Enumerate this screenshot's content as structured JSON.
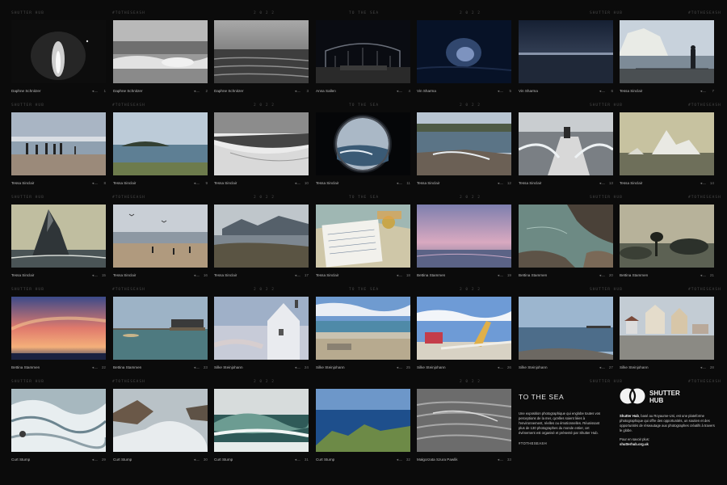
{
  "band_labels": [
    [
      "SHUTTER HUB",
      "#TOTHESEASH",
      "2 0 2 2",
      "TO THE SEA",
      "2 0 2 2",
      "SHUTTER HUB",
      "#TOTHESEASH"
    ],
    [
      "SHUTTER HUB",
      "#TOTHESEASH",
      "2 0 2 2",
      "TO THE SEA",
      "2 0 2 2",
      "SHUTTER HUB",
      "#TOTHESEASH"
    ],
    [
      "SHUTTER HUB",
      "#TOTHESEASH",
      "2 0 2 2",
      "TO THE SEA",
      "2 0 2 2",
      "SHUTTER HUB",
      "#TOTHESEASH"
    ],
    [
      "SHUTTER HUB",
      "#TOTHESEASH",
      "2 0 2 2",
      "TO THE SEA",
      "2 0 2 2",
      "SHUTTER HUB",
      "#TOTHESEASH"
    ],
    [
      "SHUTTER HUB",
      "#TOTHESEASH",
      "2 0 2 2",
      "",
      "2 0 2 2",
      "SHUTTER HUB",
      "#TOTHESEASH"
    ]
  ],
  "photos": [
    {
      "photographer": "Daphne Schnitzer",
      "number": "1"
    },
    {
      "photographer": "Daphne Schnitzer",
      "number": "2"
    },
    {
      "photographer": "Daphne Schnitzer",
      "number": "3"
    },
    {
      "photographer": "Anna Sallen",
      "number": "4"
    },
    {
      "photographer": "Vin Sharma",
      "number": "5"
    },
    {
      "photographer": "Vin Sharma",
      "number": "6"
    },
    {
      "photographer": "Tessa Sinclair",
      "number": "7"
    },
    {
      "photographer": "Tessa Sinclair",
      "number": "8"
    },
    {
      "photographer": "Tessa Sinclair",
      "number": "9"
    },
    {
      "photographer": "Tessa Sinclair",
      "number": "10"
    },
    {
      "photographer": "Tessa Sinclair",
      "number": "11"
    },
    {
      "photographer": "Tessa Sinclair",
      "number": "12"
    },
    {
      "photographer": "Tessa Sinclair",
      "number": "13"
    },
    {
      "photographer": "Tessa Sinclair",
      "number": "14"
    },
    {
      "photographer": "Tessa Sinclair",
      "number": "15"
    },
    {
      "photographer": "Tessa Sinclair",
      "number": "16"
    },
    {
      "photographer": "Tessa Sinclair",
      "number": "17"
    },
    {
      "photographer": "Tessa Sinclair",
      "number": "18"
    },
    {
      "photographer": "Bettina Stammen",
      "number": "19"
    },
    {
      "photographer": "Bettina Stammen",
      "number": "20"
    },
    {
      "photographer": "Bettina Stammen",
      "number": "21"
    },
    {
      "photographer": "Bettina Stammen",
      "number": "22"
    },
    {
      "photographer": "Bettina Stammen",
      "number": "23"
    },
    {
      "photographer": "Silke Steinjohann",
      "number": "24"
    },
    {
      "photographer": "Silke Steinjohann",
      "number": "25"
    },
    {
      "photographer": "Silke Steinjohann",
      "number": "26"
    },
    {
      "photographer": "Silke Steinjohann",
      "number": "27"
    },
    {
      "photographer": "Silke Steinjohann",
      "number": "28"
    },
    {
      "photographer": "Curt Stump",
      "number": "29"
    },
    {
      "photographer": "Curt Stump",
      "number": "30"
    },
    {
      "photographer": "Curt Stump",
      "number": "31"
    },
    {
      "photographer": "Curt Stump",
      "number": "32"
    },
    {
      "photographer": "Małgorzata Szura Pawlik",
      "number": "33"
    }
  ],
  "caption_icon": "ship-icon",
  "info": {
    "title": "TO THE SEA",
    "text": "Une exposition photographique qui englobe toutes vos perceptions de la mer, qu'elles soient liées à l'environnement, réelles ou émotionnelles. Réunissant plus de 130 photographes du monde entier, cet événement est organisé et présenté par Shutter Hub.",
    "hashtag": "#TOTHESEASH"
  },
  "brand": {
    "line1": "SHUTTER",
    "line2": "HUB",
    "about_name": "Shutter Hub",
    "about_text": ", basé au Royaume-Uni, est une plateforme photographique qui offre des opportunités, un soutien et des opportunités de réseautage aux photographes créatifs à travers le globe.",
    "more_label": "Pour en savoir plus:",
    "url": "shutterhub.org.uk"
  }
}
